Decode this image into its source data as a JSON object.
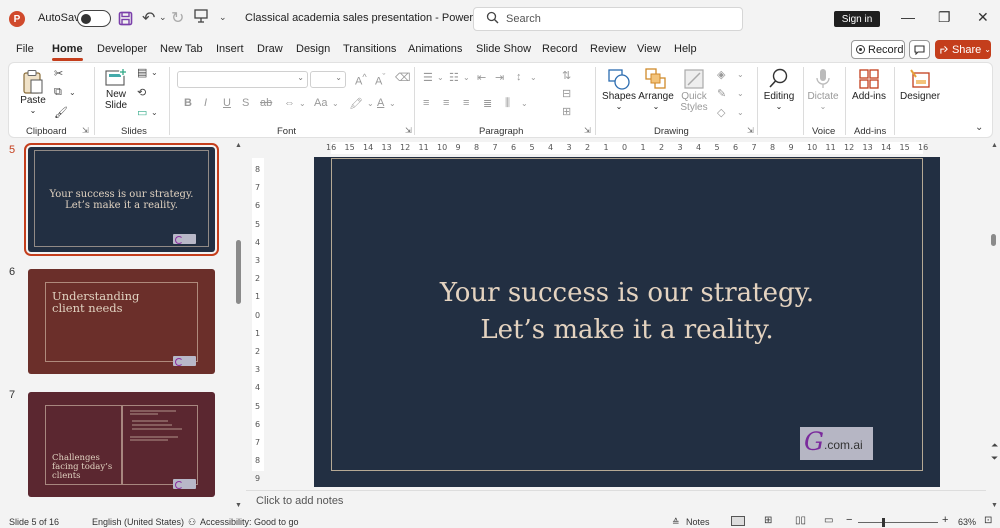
{
  "titlebar": {
    "autosave_label": "AutoSave",
    "doc_title": "Classical academia sales presentation  -  PowerP...",
    "search_placeholder": "Search",
    "signin_label": "Sign in"
  },
  "menu": {
    "tabs": [
      "File",
      "Home",
      "Developer",
      "New Tab",
      "Insert",
      "Draw",
      "Design",
      "Transitions",
      "Animations",
      "Slide Show",
      "Record",
      "Review",
      "View",
      "Help"
    ],
    "record_label": "Record",
    "share_label": "Share"
  },
  "ribbon": {
    "clipboard": {
      "paste": "Paste",
      "label": "Clipboard"
    },
    "slides": {
      "new_slide_1": "New",
      "new_slide_2": "Slide",
      "label": "Slides"
    },
    "font": {
      "label": "Font",
      "bold": "B",
      "italic": "I",
      "underline": "U",
      "strike": "S",
      "aa": "Aa"
    },
    "paragraph": {
      "label": "Paragraph"
    },
    "drawing": {
      "shapes": "Shapes",
      "arrange": "Arrange",
      "quick_styles_1": "Quick",
      "quick_styles_2": "Styles",
      "label": "Drawing"
    },
    "editing": {
      "label": "Editing"
    },
    "voice": {
      "dictate": "Dictate",
      "label": "Voice"
    },
    "addins": {
      "button": "Add-ins",
      "label": "Add-ins"
    },
    "designer": {
      "button": "Designer"
    }
  },
  "thumbnails": [
    {
      "number": "5",
      "line1": "Your success is our strategy.",
      "line2": "Let’s make it a reality."
    },
    {
      "number": "6",
      "line1": "Understanding",
      "line2": "client needs"
    },
    {
      "number": "7",
      "line1": "Challenges",
      "line2": "facing today’s",
      "line3": "clients"
    }
  ],
  "ruler": {
    "h_ticks": [
      "16",
      "15",
      "14",
      "13",
      "12",
      "11",
      "10",
      "9",
      "8",
      "7",
      "6",
      "5",
      "4",
      "3",
      "2",
      "1",
      "0",
      "1",
      "2",
      "3",
      "4",
      "5",
      "6",
      "7",
      "8",
      "9",
      "10",
      "11",
      "12",
      "13",
      "14",
      "15",
      "16"
    ],
    "v_ticks": [
      "8",
      "7",
      "6",
      "5",
      "4",
      "3",
      "2",
      "1",
      "0",
      "1",
      "2",
      "3",
      "4",
      "5",
      "6",
      "7",
      "8",
      "9"
    ]
  },
  "slide": {
    "line1": "Your success is our strategy.",
    "line2": "Let’s make it a reality.",
    "logo_letter": "G",
    "logo_text": ".com.ai",
    "bg_color": "#222f42",
    "text_color": "#e4d3c0"
  },
  "notes_placeholder": "Click to add notes",
  "status": {
    "slide_counter": "Slide 5 of 16",
    "language": "English (United States)",
    "accessibility": "Accessibility: Good to go",
    "notes": "Notes",
    "zoom": "63%"
  },
  "colors": {
    "accent": "#c43e1c",
    "slide6_bg": "#6b2f2a",
    "slide7_bg": "#5b2730"
  }
}
